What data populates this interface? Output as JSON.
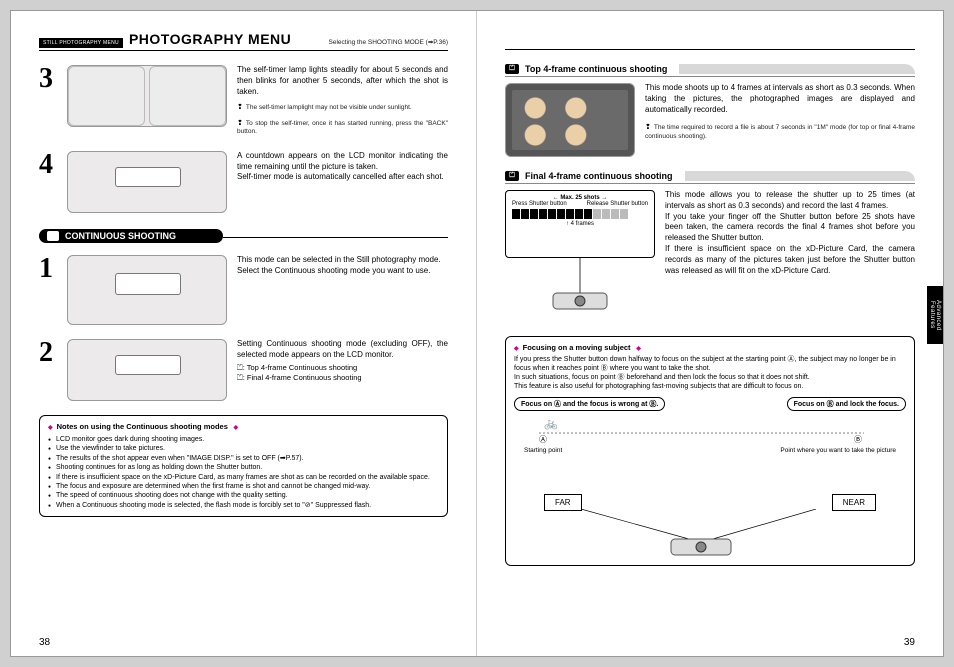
{
  "left": {
    "menu_tag": "STILL PHOTOGRAPHY MENU",
    "menu_title": "PHOTOGRAPHY MENU",
    "selecting": "Selecting the SHOOTING MODE (➡P.36)",
    "step3": {
      "text": "The self-timer lamp lights steadily for about 5 seconds and then blinks for another 5 seconds, after which the shot is taken.",
      "note1": "The self-timer lamplight may not be visible under sunlight.",
      "note2": "To stop the self-timer, once it has started running, press the \"BACK\" button."
    },
    "step4": {
      "text": "A countdown appears on the LCD monitor indicating the time remaining until the picture is taken.\nSelf-timer mode is automatically cancelled after each shot."
    },
    "cont_title": "CONTINUOUS SHOOTING",
    "step1": {
      "text": "This mode can be selected in the Still photography mode.\nSelect the Continuous shooting mode you want to use."
    },
    "step2": {
      "text": "Setting Continuous shooting mode (excluding OFF), the selected mode appears on the LCD monitor.",
      "icon1": ": Top 4-frame Continuous shooting",
      "icon2": ": Final 4-frame Continuous shooting"
    },
    "notes_title": "Notes on using the Continuous shooting modes",
    "notes": [
      "LCD monitor goes dark during shooting images.",
      "Use the viewfinder to take pictures.",
      "The results of the shot appear even when \"IMAGE DISP.\" is set to OFF (➡P.57).",
      "Shooting continues for as long as holding down the Shutter button.",
      "If there is insufficient space on the xD-Picture Card, as many frames are shot as can be recorded on the available space.",
      "The focus and exposure are determined when the first frame is shot and cannot be changed mid-way.",
      "The speed of continuous shooting does not change with the quality setting.",
      "When a Continuous shooting mode is selected, the flash mode is forcibly set to \"⊘\" Suppressed flash."
    ],
    "page_num": "38"
  },
  "right": {
    "top4_title": "Top 4-frame continuous shooting",
    "top4_text": "This mode shoots up to 4 frames at intervals as short as 0.3 seconds. When taking the pictures, the photographed images are displayed and automatically recorded.",
    "top4_note": "The time required to record a file is about 7 seconds in \"1M\" mode (for top or final 4-frame continuous shooting).",
    "final4_title": "Final 4-frame continuous shooting",
    "final4_text": "This mode allows you to release the shutter up to 25 times (at intervals as short as 0.3 seconds) and record the last 4 frames.\nIf you take your finger off the Shutter button before 25 shots have been taken, the camera records the final 4 frames shot before you released the Shutter button.\nIf there is insufficient space on the xD-Picture Card, the camera records as many of the pictures taken just before the Shutter button was released as will fit on the xD-Picture Card.",
    "timeline": {
      "max": "Max. 25 shots",
      "press": "Press Shutter button",
      "release": "Release Shutter button",
      "four_frames": "4 frames"
    },
    "focus_title": "Focusing on a moving subject",
    "focus_body": "If you press the Shutter button down halfway to focus on the subject at the starting point Ⓐ, the subject may no longer be in focus when it reaches point Ⓑ where you want to take the shot.\nIn such situations, focus on point Ⓑ beforehand and then lock the focus so that it does not shift.\nThis feature is also useful for photographing fast-moving subjects that are difficult to focus on.",
    "pill_a": "Focus on Ⓐ and the focus is wrong at Ⓑ.",
    "pill_b": "Focus on Ⓑ and lock the focus.",
    "starting": "Starting point",
    "point_take": "Point where you want to take the picture",
    "far": "FAR",
    "near": "NEAR",
    "side_tab": "Advanced Features",
    "page_num": "39"
  }
}
